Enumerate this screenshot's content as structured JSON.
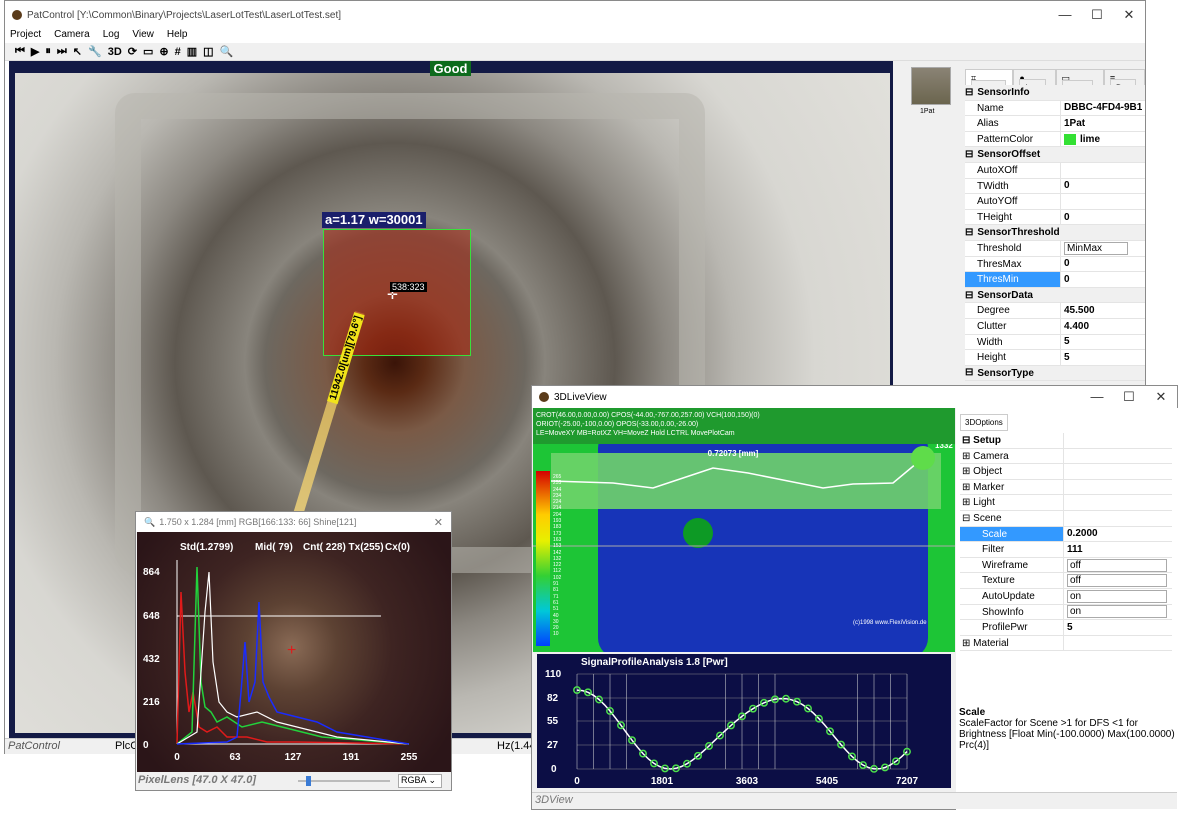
{
  "main_window": {
    "title": "PatControl [Y:\\Common\\Binary\\Projects\\LaserLotTest\\LaserLotTest.set]",
    "controls": [
      "—",
      "☐",
      "✕"
    ],
    "menu": [
      "Project",
      "Camera",
      "Log",
      "View",
      "Help"
    ],
    "toolbar_text": [
      "3D"
    ],
    "status_label": "Good",
    "overlay": {
      "roi_label": "a=1.17 w=30001",
      "coord_label": "538:323",
      "measure_label": "11942.0[um][79.6°]"
    },
    "statusbar": {
      "app_label": "PatControl",
      "left": "PlcCr",
      "right": "Hz(1.44)"
    }
  },
  "layer_panel": {
    "thumbnail_label": "1Pat",
    "tabs": [
      "Layer",
      "Lua",
      "Com",
      "Dat"
    ],
    "rows": [
      {
        "cat": "SensorInfo"
      },
      {
        "k": "Name",
        "v": "DBBC-4FD4-9B1"
      },
      {
        "k": "Alias",
        "v": "1Pat"
      },
      {
        "k": "PatternColor",
        "v": "lime",
        "swatch": "#33e033"
      },
      {
        "cat": "SensorOffset"
      },
      {
        "k": "AutoXOff",
        "v": ""
      },
      {
        "k": "TWidth",
        "v": "0"
      },
      {
        "k": "AutoYOff",
        "v": ""
      },
      {
        "k": "THeight",
        "v": "0"
      },
      {
        "cat": "SensorThreshold"
      },
      {
        "k": "Threshold",
        "v": "MinMax",
        "dropdown": true
      },
      {
        "k": "ThresMax",
        "v": "0"
      },
      {
        "k": "ThresMin",
        "v": "0",
        "selected": true
      },
      {
        "cat": "SensorData"
      },
      {
        "k": "Degree",
        "v": "45.500"
      },
      {
        "k": "Clutter",
        "v": "4.400"
      },
      {
        "k": "Width",
        "v": "5"
      },
      {
        "k": "Height",
        "v": "5"
      },
      {
        "cat": "SensorType"
      }
    ]
  },
  "pixel_lens": {
    "title": "1.750 x 1.284 [mm] RGB[166:133: 66] Shine[121]",
    "stats": [
      "Std(1.2799)",
      "Mid( 79)",
      "Cnt( 228) Tx(255)",
      "Cx(0)"
    ],
    "y_ticks": [
      "864",
      "648",
      "432",
      "216",
      "0"
    ],
    "x_ticks": [
      "0",
      "63",
      "127",
      "191",
      "255"
    ],
    "footer": "PixelLens  [47.0 X 47.0]",
    "mode": "RGBA"
  },
  "view3d": {
    "title": "3DLiveView",
    "controls": [
      "—",
      "☐",
      "✕"
    ],
    "info_lines": [
      "CROT(46.00,0.00,0.00) CPOS(-44.00,-767.00,257.00) VCH(100,150)(0)",
      "ORIOT(-25.00,-100,0.00) OPOS(-33.00,0.00,-26.00)",
      "LE=MoveXY MB=RotXZ VH=MoveZ  Hold LCTRL MovePlotCam"
    ],
    "profile_width_label": "0.72073 [mm]",
    "corner_value": "1332",
    "colorbar_values": [
      "265",
      "255",
      "244",
      "234",
      "224",
      "214",
      "204",
      "193",
      "183",
      "173",
      "163",
      "153",
      "142",
      "132",
      "122",
      "112",
      "102",
      "91",
      "81",
      "71",
      "61",
      "51",
      "40",
      "30",
      "20",
      "10"
    ],
    "copyright": "(c)1998 www.FlexiVision.de",
    "options_tab": "3DOptions",
    "options": [
      {
        "cat": "Setup",
        "open": true
      },
      {
        "k": "Camera",
        "group": true
      },
      {
        "k": "Object",
        "group": true
      },
      {
        "k": "Marker",
        "group": true
      },
      {
        "k": "Light",
        "group": true
      },
      {
        "k": "Scene",
        "group": true,
        "open": true
      },
      {
        "k": "Scale",
        "v": "0.2000",
        "sub": true,
        "selected": true
      },
      {
        "k": "Filter",
        "v": "111",
        "sub": true
      },
      {
        "k": "Wireframe",
        "v": "off",
        "sub": true,
        "dropdown": true
      },
      {
        "k": "Texture",
        "v": "off",
        "sub": true,
        "dropdown": true
      },
      {
        "k": "AutoUpdate",
        "v": "on",
        "sub": true,
        "dropdown": true
      },
      {
        "k": "ShowInfo",
        "v": "on",
        "sub": true,
        "dropdown": true
      },
      {
        "k": "ProfilePwr",
        "v": "5",
        "sub": true
      },
      {
        "k": "Material",
        "group": true
      }
    ],
    "help": {
      "title": "Scale",
      "text": "ScaleFactor for Scene >1 for DFS <1 for Brightness [Float Min(-100.0000) Max(100.0000) Prc(4)]"
    },
    "signal": {
      "title": "SignalProfileAnalysis 1.8 [Pwr]",
      "y_ticks": [
        "110",
        "82",
        "55",
        "27",
        "0"
      ],
      "x_ticks": [
        "0",
        "1801",
        "3603",
        "5405",
        "7207"
      ]
    },
    "footer": "3DView"
  }
}
